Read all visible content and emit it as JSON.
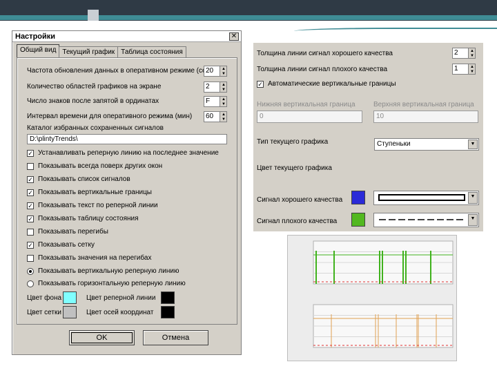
{
  "dialog": {
    "title": "Настройки",
    "tabs": [
      "Общий вид",
      "Текущий график",
      "Таблица состояния"
    ],
    "fields": [
      {
        "label": "Частота обновления данных в оперативном режиме (сек)",
        "value": "20"
      },
      {
        "label": "Количество областей графиков на экране",
        "value": "2"
      },
      {
        "label": "Число знаков после запятой в ординатах",
        "value": "F"
      },
      {
        "label": "Интервал времени для оперативного режима (мин)",
        "value": "60"
      }
    ],
    "catalog_label": "Каталог избранных сохраненных сигналов",
    "catalog_path": "D:\\plintyTrends\\",
    "checks": [
      {
        "label": "Устанавливать реперную линию на последнее значение",
        "checked": true
      },
      {
        "label": "Показывать всегда поверх других окон",
        "checked": false
      },
      {
        "label": "Показывать список сигналов",
        "checked": true
      },
      {
        "label": "Показывать вертикальные границы",
        "checked": true
      },
      {
        "label": "Показывать текст по реперной линии",
        "checked": true
      },
      {
        "label": "Показывать таблицу состояния",
        "checked": true
      },
      {
        "label": "Показывать перегибы",
        "checked": false
      },
      {
        "label": "Показывать сетку",
        "checked": true
      },
      {
        "label": "Показывать значения на перегибах",
        "checked": false
      }
    ],
    "radios": [
      {
        "label": "Показывать вертикальную реперную линию",
        "selected": true
      },
      {
        "label": "Показывать горизонтальную реперную линию",
        "selected": false
      }
    ],
    "colors": {
      "bg_label": "Цвет фона",
      "bg_color": "#80ffff",
      "grid_label": "Цвет сетки",
      "grid_color": "#c0c0c0",
      "ref_label": "Цвет реперной линии",
      "ref_color": "#000000",
      "axes_label": "Цвет осей координат",
      "axes_color": "#000000"
    },
    "ok_label": "OK",
    "cancel_label": "Отмена",
    "close_glyph": "✕"
  },
  "right_panel": {
    "good_width_label": "Толщина линии сигнал хорошего качества",
    "good_width_value": "2",
    "bad_width_label": "Толщина линии сигнал плохого качества",
    "bad_width_value": "1",
    "auto_bounds_label": "Автоматические вертикальные границы",
    "auto_bounds_checked": true,
    "lower_label": "Нижняя вертикальная граница",
    "lower_value": "0",
    "upper_label": "Верхняя вертикальная граница",
    "upper_value": "10",
    "chart_type_label": "Тип текущего графика",
    "chart_type_value": "Ступеньки",
    "chart_color_label": "Цвет текущего графика",
    "good_signal_label": "Сигнал хорошего качества",
    "good_signal_color": "#2a2ad8",
    "bad_signal_label": "Сигнал плохого качества",
    "bad_signal_color": "#52b820"
  },
  "accents": {
    "deco_dark": "#2f3a45",
    "deco_teal": "#3f8c95",
    "chart_green": "#3fb21c",
    "chart_orange": "#e0a050",
    "chart_red": "#e03030"
  }
}
